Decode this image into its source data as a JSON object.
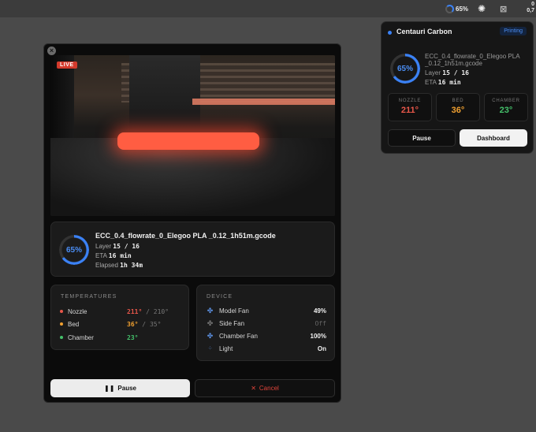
{
  "menubar": {
    "progress_label": "65%",
    "cpu_top": "0",
    "cpu_bottom": "0,7"
  },
  "window": {
    "live_label": "LIVE",
    "job": {
      "progress": "65%",
      "filename": "ECC_0.4_flowrate_0_Elegoo PLA _0.12_1h51m.gcode",
      "layer_label": "Layer",
      "layer_value": "15 / 16",
      "eta_label": "ETA",
      "eta_value": "16 min",
      "elapsed_label": "Elapsed",
      "elapsed_value": "1h 34m"
    },
    "temperatures": {
      "title": "TEMPERATURES",
      "rows": [
        {
          "name": "Nozzle",
          "current": "211°",
          "sep": "/",
          "target": "210°",
          "color": "#e8574a"
        },
        {
          "name": "Bed",
          "current": "36°",
          "sep": "/",
          "target": "35°",
          "color": "#f0a030"
        },
        {
          "name": "Chamber",
          "current": "23°",
          "sep": "",
          "target": "",
          "color": "#44c06a"
        }
      ]
    },
    "device": {
      "title": "DEVICE",
      "rows": [
        {
          "name": "Model Fan",
          "value": "49%",
          "icon": "fan-icon"
        },
        {
          "name": "Side Fan",
          "value": "Off",
          "icon": "fan-icon"
        },
        {
          "name": "Chamber Fan",
          "value": "100%",
          "icon": "fan-icon"
        },
        {
          "name": "Light",
          "value": "On",
          "icon": "light-icon"
        }
      ]
    },
    "pause_label": "Pause",
    "cancel_label": "Cancel"
  },
  "popover": {
    "title": "Centauri Carbon",
    "status": "Printing",
    "progress": "65%",
    "filename": "ECC_0.4_flowrate_0_Elegoo PLA _0.12_1h51m.gcode",
    "filename_display": "ECC_0.4_flowrate_0_Elegoo PLA",
    "filename_line2": "_0.12_1h51m.gcode",
    "layer_label": "Layer",
    "layer_value": "15 / 16",
    "eta_label": "ETA",
    "eta_value": "16 min",
    "temps": [
      {
        "label": "NOZZLE",
        "value": "211°",
        "color": "#e8574a"
      },
      {
        "label": "BED",
        "value": "36°",
        "color": "#f0a030"
      },
      {
        "label": "CHAMBER",
        "value": "23°",
        "color": "#44c06a"
      }
    ],
    "pause_label": "Pause",
    "dashboard_label": "Dashboard"
  }
}
